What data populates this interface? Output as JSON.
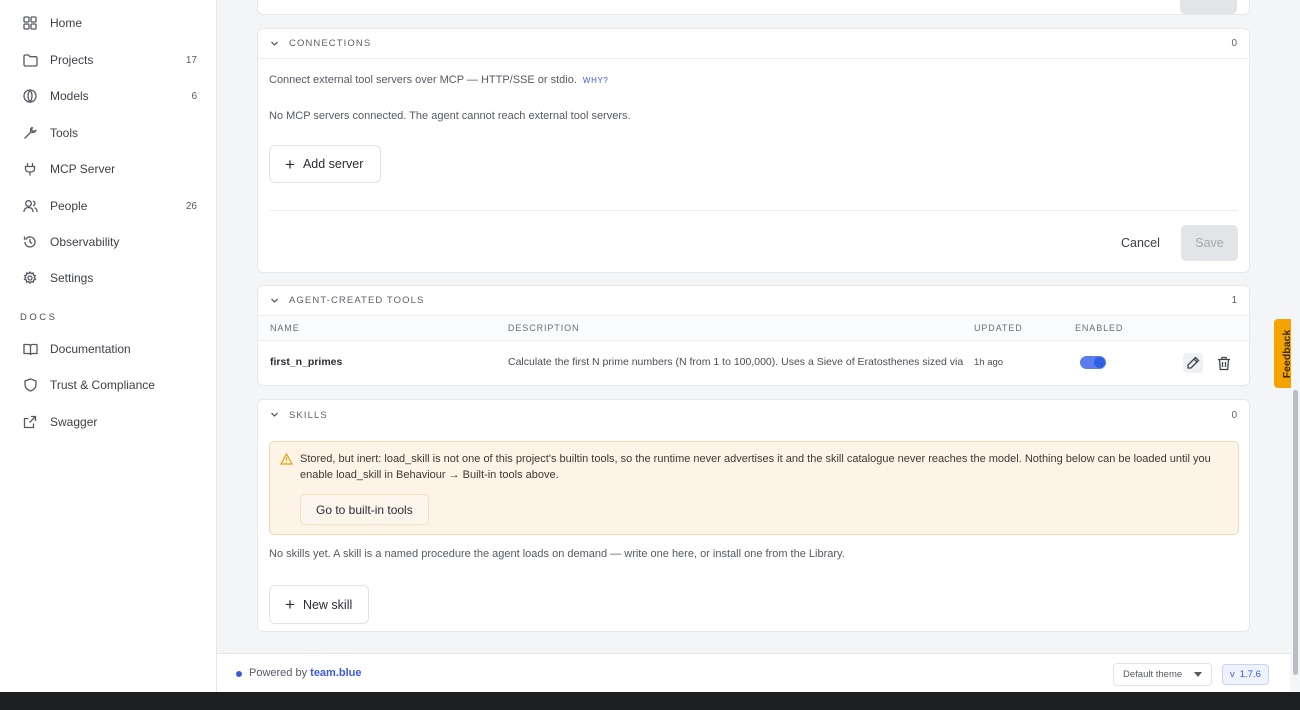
{
  "sidebar": {
    "items": [
      {
        "label": "Home",
        "count": "",
        "icon": "grid-icon"
      },
      {
        "label": "Projects",
        "count": "17",
        "icon": "folder-icon"
      },
      {
        "label": "Models",
        "count": "6",
        "icon": "globe-icon"
      },
      {
        "label": "Tools",
        "count": "",
        "icon": "wrench-icon"
      },
      {
        "label": "MCP Server",
        "count": "",
        "icon": "plug-icon"
      },
      {
        "label": "People",
        "count": "26",
        "icon": "users-icon"
      },
      {
        "label": "Observability",
        "count": "",
        "icon": "history-icon"
      },
      {
        "label": "Settings",
        "count": "",
        "icon": "gear-icon"
      }
    ],
    "docs_heading": "DOCS",
    "docs_items": [
      {
        "label": "Documentation",
        "icon": "book-icon"
      },
      {
        "label": "Trust & Compliance",
        "icon": "shield-icon"
      },
      {
        "label": "Swagger",
        "icon": "external-link-icon"
      }
    ]
  },
  "connections": {
    "title": "CONNECTIONS",
    "count": "0",
    "description": "Connect external tool servers over MCP — HTTP/SSE or stdio.",
    "why_link": "WHY?",
    "empty_text": "No MCP servers connected. The agent cannot reach external tool servers.",
    "add_button": "Add server",
    "cancel_label": "Cancel",
    "save_label": "Save"
  },
  "agent_tools": {
    "title": "AGENT-CREATED TOOLS",
    "count": "1",
    "columns": [
      "NAME",
      "DESCRIPTION",
      "UPDATED",
      "ENABLED"
    ],
    "rows": [
      {
        "name": "first_n_primes",
        "description": "Calculate the first N prime numbers (N from 1 to 100,000). Uses a Sieve of Eratosthenes sized via t...",
        "updated": "1h ago",
        "enabled": true
      }
    ]
  },
  "skills": {
    "title": "SKILLS",
    "count": "0",
    "warning": "Stored, but inert: load_skill is not one of this project's builtin tools, so the runtime never advertises it and the skill catalogue never reaches the model. Nothing below can be loaded until you enable load_skill in Behaviour → Built-in tools above.",
    "warning_button": "Go to built-in tools",
    "empty_text": "No skills yet. A skill is a named procedure the agent loads on demand — write one here, or install one from the Library.",
    "new_button": "New skill"
  },
  "footer": {
    "powered_prefix": "Powered by",
    "powered_brand": "team.blue",
    "theme_select": "Default theme",
    "version_prefix": "v",
    "version": "1.7.6"
  },
  "feedback_label": "Feedback",
  "colors": {
    "accent": "#3b5bdb",
    "feedback": "#f5a300",
    "warning_bg": "#fdf3e6"
  }
}
